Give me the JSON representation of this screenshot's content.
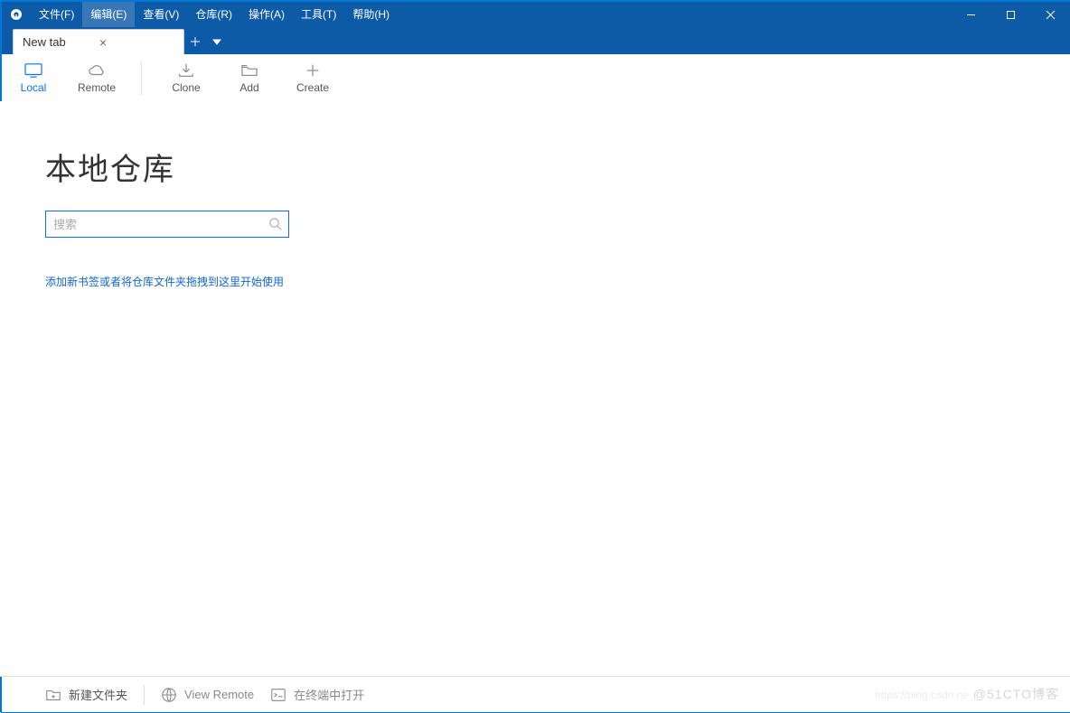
{
  "menus": {
    "file": "文件(F)",
    "edit": "编辑(E)",
    "view": "查看(V)",
    "repo": "仓库(R)",
    "action": "操作(A)",
    "tools": "工具(T)",
    "help": "帮助(H)"
  },
  "tab": {
    "title": "New tab"
  },
  "toolbar": {
    "local": "Local",
    "remote": "Remote",
    "clone": "Clone",
    "add": "Add",
    "create": "Create"
  },
  "page": {
    "heading": "本地仓库",
    "search_placeholder": "搜索",
    "hint": "添加新书签或者将仓库文件夹拖拽到这里开始使用"
  },
  "statusbar": {
    "new_folder": "新建文件夹",
    "view_remote": "View Remote",
    "open_terminal": "在终端中打开"
  },
  "watermark": "@51CTO博客",
  "watermark2": "https://blog.csdn.ne"
}
